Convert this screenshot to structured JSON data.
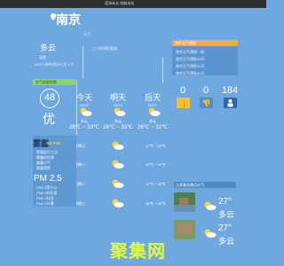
{
  "topbar": {
    "text": "蓝海站长 电脑本站"
  },
  "city": {
    "name": "南京",
    "weather_label": "天气",
    "update": "三小时预报数据",
    "current_cond": "多云",
    "sub1": "温度",
    "sub2": "06/22 周四/农历七月十九"
  },
  "aqi": {
    "panel_label": "空气质量指数",
    "value": "48",
    "level": "优"
  },
  "days": [
    {
      "name": "今天",
      "date": "06/22",
      "cond": "多云",
      "temp": "26℃ ~ 33℃"
    },
    {
      "name": "明天",
      "date": "06/23",
      "cond": "多云",
      "temp": "26℃ ~ 33℃"
    },
    {
      "name": "后天",
      "date": "06/24",
      "cond": "多云",
      "temp": "26℃ ~ 32℃"
    }
  ],
  "hourly": [
    {
      "name": "星期日",
      "temp": "27℃ ~ 33℃"
    },
    {
      "name": "星期一",
      "temp": "26℃ ~ 32℃"
    },
    {
      "name": "星期二",
      "temp": "27℃ ~ 32℃"
    },
    {
      "name": "星期三",
      "temp": "26℃ ~ 33℃"
    }
  ],
  "left_panel": {
    "title": "雾霾",
    "subtitle": "wu mai",
    "items": [
      "雾霾图片大全",
      "雾霾的危害",
      "雾霾天气",
      "雾霾预警"
    ],
    "pm_title": "PM 2.5",
    "pm_items": [
      "PM2.5是什么",
      "PM2.5的危害",
      "PM2.5标准",
      "PM2.5口罩"
    ]
  },
  "right_panel": {
    "head": "南京天气预报",
    "items": [
      "南京天气预报一周",
      "南京天气预报15天",
      "南京天气预报30天",
      "南京天气预报40天"
    ]
  },
  "stats": [
    {
      "value": "0",
      "icon": "thumb-up-icon"
    },
    {
      "value": "0",
      "icon": "thumb-down-icon"
    },
    {
      "value": "184",
      "icon": "people-icon"
    }
  ],
  "news": {
    "title": "江苏著名景点天气",
    "items": [
      {
        "temp": "27°",
        "cond": "多云"
      },
      {
        "temp": "27°",
        "cond": "多云"
      }
    ]
  },
  "watermark": "聚集网"
}
